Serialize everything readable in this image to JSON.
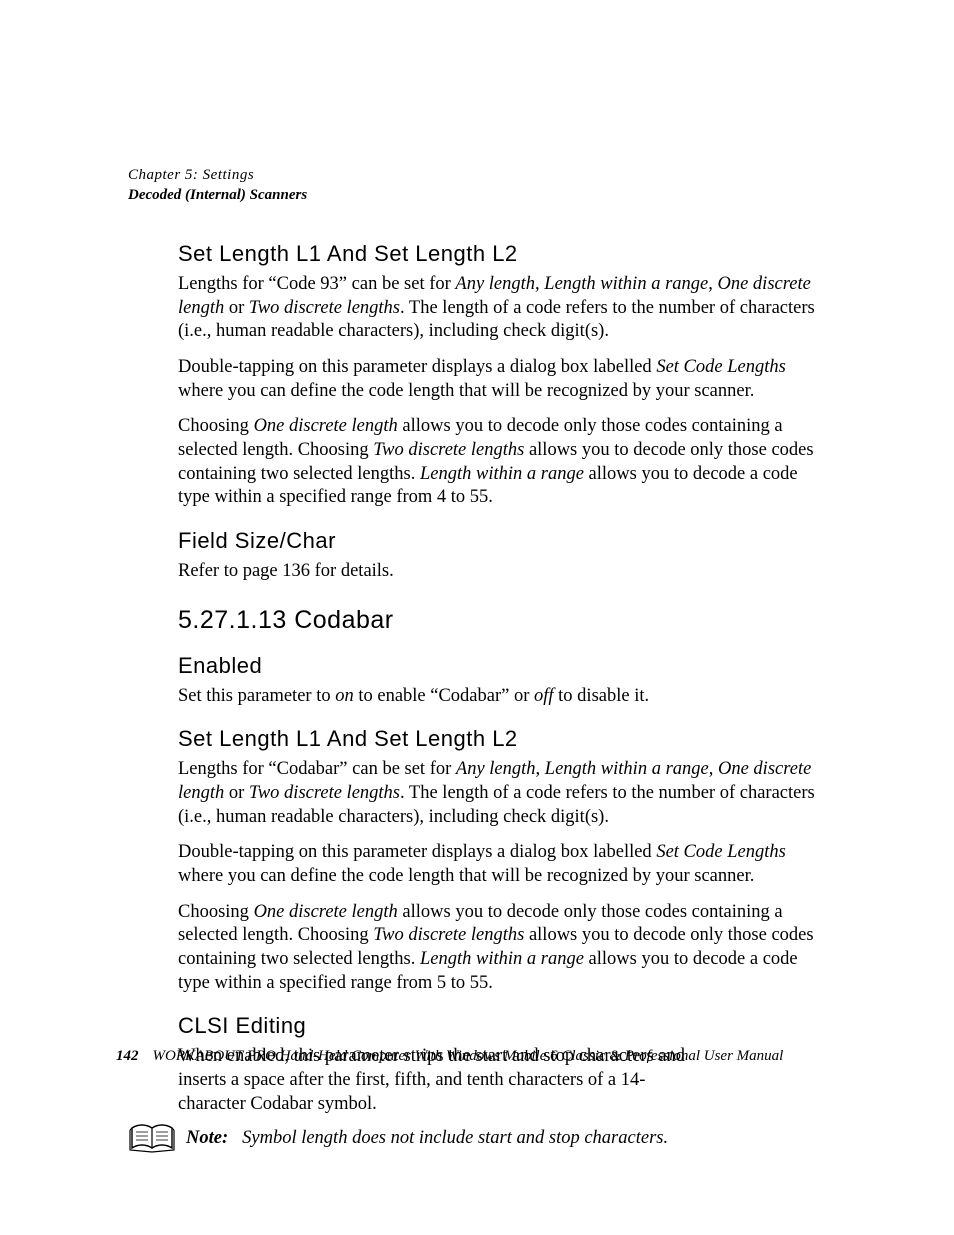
{
  "header": {
    "chapter_line": "Chapter 5: Settings",
    "section_line": "Decoded (Internal) Scanners"
  },
  "s1": {
    "h": "Set Length L1 And Set Length L2",
    "p1a": "Lengths for “Code 93” can be set for ",
    "p1b": "Any length",
    "p1c": ", ",
    "p1d": "Length within a range",
    "p1e": ", ",
    "p1f": "One discrete length",
    "p1g": " or ",
    "p1h": "Two discrete lengths",
    "p1i": ". The length of a code refers to the number of characters (i.e., human readable characters), including check digit(s).",
    "p2a": "Double-tapping on this parameter displays a dialog box labelled ",
    "p2b": "Set Code Lengths",
    "p2c": " where you can define the code length that will be recognized by your scanner.",
    "p3a": "Choosing ",
    "p3b": "One discrete length",
    "p3c": " allows you to decode only those codes containing a selected length. Choosing ",
    "p3d": "Two discrete lengths",
    "p3e": " allows you to decode only those codes containing two selected lengths. ",
    "p3f": "Length within a range",
    "p3g": " allows you to decode a code type within a specified range from 4 to 55."
  },
  "s2": {
    "h": "Field Size/Char",
    "p1": "Refer to page 136 for details."
  },
  "s3": {
    "h": "5.27.1.13   Codabar"
  },
  "s4": {
    "h": "Enabled",
    "p1a": "Set this parameter to ",
    "p1b": "on",
    "p1c": " to enable “Codabar” or ",
    "p1d": "off",
    "p1e": " to disable it."
  },
  "s5": {
    "h": "Set Length L1 And Set Length L2",
    "p1a": "Lengths for “Codabar” can be set for ",
    "p1b": "Any length",
    "p1c": ", ",
    "p1d": "Length within a range",
    "p1e": ", ",
    "p1f": "One discrete length",
    "p1g": " or ",
    "p1h": "Two discrete lengths",
    "p1i": ". The length of a code refers to the number of characters (i.e., human readable characters), including check digit(s).",
    "p2a": "Double-tapping on this parameter displays a dialog box labelled ",
    "p2b": "Set Code Lengths",
    "p2c": " where you can define the code length that will be recognized by your scanner.",
    "p3a": "Choosing ",
    "p3b": "One discrete length",
    "p3c": " allows you to decode only those codes containing a selected length. Choosing ",
    "p3d": "Two discrete lengths",
    "p3e": " allows you to decode only those codes containing two selected lengths. ",
    "p3f": "Length within a range",
    "p3g": " allows you to decode a code type within a specified range from 5 to 55."
  },
  "s6": {
    "h": "CLSI Editing",
    "p1": "When enabled, this parameter strips the start and stop characters and inserts a space after the first, fifth, and tenth characters of a 14-character Codabar symbol.",
    "note_label": "Note:",
    "note_text": "Symbol length does not include start and stop characters."
  },
  "footer": {
    "page": "142",
    "text": "WORKABOUT PRO Hand-Held Computer With Windows Mobile 6 Classic & Professional User Manual"
  }
}
